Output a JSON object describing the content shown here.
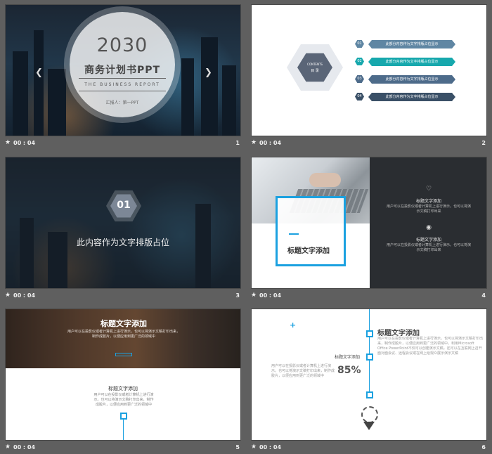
{
  "colors": {
    "teal": "#17a8ad",
    "blue": "#1ba1e0",
    "slate": "#5a7894",
    "dark": "#2a2d31",
    "gray_bg": "#5f5f5f"
  },
  "slides": [
    {
      "num": "1",
      "time": "00 : 04",
      "year": "2030",
      "title": "商务计划书PPT",
      "subtitle": "THE BUSINESS REPORT",
      "presenter": "汇报人：第一PPT",
      "prev_icon": "chevron-left-icon",
      "next_icon": "chevron-right-icon"
    },
    {
      "num": "2",
      "time": "00 : 04",
      "center_title": "CONTENTS",
      "center_sub": "目 录",
      "items": [
        {
          "badge": "01",
          "text": "此部分内容作为文字排版占位显示",
          "color": "#5f86a3"
        },
        {
          "badge": "02",
          "text": "此部分内容作为文字排版占位显示",
          "color": "#17a8ad"
        },
        {
          "badge": "03",
          "text": "此部分内容作为文字排版占位显示",
          "color": "#4d6b8a"
        },
        {
          "badge": "04",
          "text": "此部分内容作为文字排版占位显示",
          "color": "#3a5067"
        }
      ]
    },
    {
      "num": "3",
      "time": "00 : 04",
      "badge": "01",
      "text": "此内容作为文字排版占位"
    },
    {
      "num": "4",
      "time": "00 : 04",
      "box_title": "标题文字添加",
      "blocks": [
        {
          "icon": "heart-icon",
          "title": "标题文字添加",
          "body": "用户可以在投影仪或者计算机上进行演示。也可以将演示文稿打印出来"
        },
        {
          "icon": "camera-icon",
          "title": "标题文字添加",
          "body": "用户可以在投影仪或者计算机上进行演示。也可以将演示文稿打印出来"
        }
      ]
    },
    {
      "num": "5",
      "time": "00 : 04",
      "top_title": "标题文字添加",
      "top_body": "用户可以在投影仪或者计算机上进行演示。也可以将演示文稿打印出来，制作成胶片，以便应用到更广泛的领域中",
      "mid_title": "标题文字添加",
      "mid_body": "用户可以在投影仪或者计算机上进行演示。也可以将演示文稿打印出来，制作成胶片，以便应用到更广泛的领域中"
    },
    {
      "num": "6",
      "time": "00 : 04",
      "plus": "+",
      "right_title": "标题文字添加",
      "right_body": "用户可以在投影仪或者计算机上进行演示。也可以将演示文稿打印出来，制作成胶片，以便应用到更广泛的领域中。利用Microsoft Office PowerPoint不仅可以创建演示文稿，还可以在互联网上召开面对面会议、远程会议或在网上给观众展示演示文稿",
      "left_title": "标题文字添加",
      "left_body": "用户可以在投影仪或者计算机上进行演示。也可以将演示文稿打印出来，制作成胶片，以便应用到更广泛的领域中",
      "percent": "85%",
      "award_icon": "award-icon"
    }
  ]
}
